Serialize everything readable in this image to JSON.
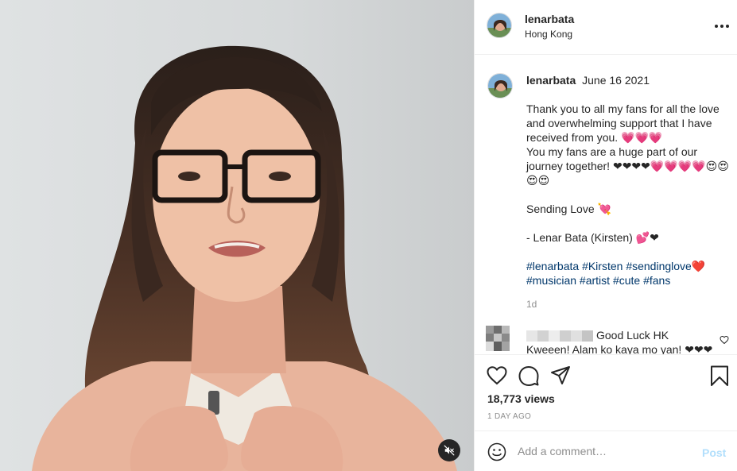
{
  "post": {
    "username": "lenarbata",
    "location": "Hong Kong",
    "date": "June 16 2021",
    "caption_lines": [
      "Thank you to all my fans for all the love and overwhelming support that I have received from you. 💗💗💗",
      "You my fans are a huge part of our journey together! ❤❤❤❤💗💗💗💗😍😍😍😍",
      "",
      "Sending Love 💘",
      "",
      "- Lenar Bata (Kirsten) 💕❤"
    ],
    "hashtags": [
      "#lenarbata",
      "#Kirsten",
      "#sendinglove❤️",
      "#musician",
      "#artist",
      "#cute",
      "#fans"
    ],
    "time_ago": "1d",
    "views": "18,773 views",
    "posted_ago": "1 DAY AGO"
  },
  "comment": {
    "text": "Good Luck HK",
    "text2": "Kweeen! Alam ko kaya mo yan! ❤❤❤"
  },
  "add_comment": {
    "placeholder": "Add a comment…",
    "post_label": "Post"
  },
  "icons": {
    "more": "more-horizontal-icon",
    "like": "heart-icon",
    "comment": "comment-bubble-icon",
    "share": "paper-plane-icon",
    "save": "bookmark-icon",
    "mute": "speaker-muted-icon",
    "emoji": "smiley-icon"
  },
  "colors": {
    "hashtag": "#00376b",
    "muted_text": "#8e8e8e",
    "post_button_disabled": "#b2dffc",
    "heart": "#ed4956"
  }
}
